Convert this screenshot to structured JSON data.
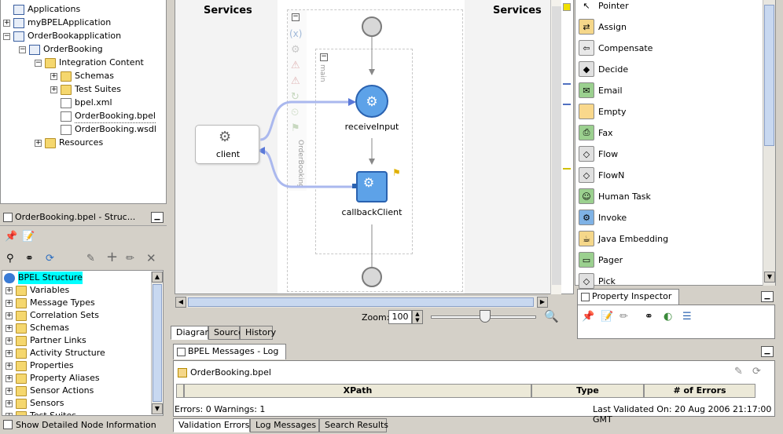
{
  "app_tree": {
    "items": [
      {
        "label": "Applications",
        "level": 0,
        "expander": "",
        "icon": "applications-icon"
      },
      {
        "label": "myBPELApplication",
        "level": 0,
        "expander": "+",
        "icon": "application-icon"
      },
      {
        "label": "OrderBookapplication",
        "level": 0,
        "expander": "−",
        "icon": "application-icon"
      },
      {
        "label": "OrderBooking",
        "level": 1,
        "expander": "−",
        "icon": "project-icon"
      },
      {
        "label": "Integration Content",
        "level": 2,
        "expander": "−",
        "icon": "folder-icon"
      },
      {
        "label": "Schemas",
        "level": 3,
        "expander": "+",
        "icon": "folder-icon"
      },
      {
        "label": "Test Suites",
        "level": 3,
        "expander": "+",
        "icon": "folder-icon"
      },
      {
        "label": "bpel.xml",
        "level": 3,
        "expander": "",
        "icon": "xml-file-icon"
      },
      {
        "label": "OrderBooking.bpel",
        "level": 3,
        "expander": "",
        "icon": "bpel-file-icon"
      },
      {
        "label": "OrderBooking.wsdl",
        "level": 3,
        "expander": "",
        "icon": "wsdl-file-icon"
      },
      {
        "label": "Resources",
        "level": 2,
        "expander": "+",
        "icon": "folder-icon"
      }
    ]
  },
  "structure_panel": {
    "title": "OrderBooking.bpel - Struc...",
    "root": "BPEL Structure",
    "items": [
      "Variables",
      "Message Types",
      "Correlation Sets",
      "Schemas",
      "Partner Links",
      "Activity Structure",
      "Properties",
      "Property Aliases",
      "Sensor Actions",
      "Sensors",
      "Test Suites"
    ],
    "show_detailed": "Show Detailed Node Information"
  },
  "diagram": {
    "services_left": "Services",
    "services_right": "Services",
    "client_label": "client",
    "receive_label": "receiveInput",
    "callback_label": "callbackClient",
    "scope_label": "main",
    "process_label": "OrderBooking",
    "zoom_label": "Zoom:",
    "zoom_value": "100",
    "tabs": [
      "Diagram",
      "Source",
      "History"
    ]
  },
  "palette": {
    "items": [
      {
        "label": "Pointer",
        "glyph": "↖",
        "bg": "#ffffff"
      },
      {
        "label": "Assign",
        "glyph": "⇄",
        "bg": "#f5d78a"
      },
      {
        "label": "Compensate",
        "glyph": "⇦",
        "bg": "#e8e8e8"
      },
      {
        "label": "Decide",
        "glyph": "◆",
        "bg": "#e0e0e0"
      },
      {
        "label": "Email",
        "glyph": "✉",
        "bg": "#9bd08f"
      },
      {
        "label": "Empty",
        "glyph": "",
        "bg": "#f9d88c"
      },
      {
        "label": "Fax",
        "glyph": "⎙",
        "bg": "#9bd08f"
      },
      {
        "label": "Flow",
        "glyph": "◇",
        "bg": "#e0e0e0"
      },
      {
        "label": "FlowN",
        "glyph": "◇",
        "bg": "#e0e0e0"
      },
      {
        "label": "Human Task",
        "glyph": "☺",
        "bg": "#9bd08f"
      },
      {
        "label": "Invoke",
        "glyph": "⚙",
        "bg": "#7fb2e5"
      },
      {
        "label": "Java Embedding",
        "glyph": "☕",
        "bg": "#f5d78a"
      },
      {
        "label": "Pager",
        "glyph": "▭",
        "bg": "#9bd08f"
      },
      {
        "label": "Pick",
        "glyph": "◇",
        "bg": "#e0e0e0"
      }
    ]
  },
  "property_inspector": {
    "title": "Property Inspector"
  },
  "log": {
    "title": "BPEL Messages - Log",
    "file": "OrderBooking.bpel",
    "columns": [
      "XPath",
      "Type",
      "# of Errors"
    ],
    "status_left": "Errors: 0 Warnings: 1",
    "status_right": "Last Validated On: 20 Aug 2006 21:17:00 GMT",
    "tabs": [
      "Validation Errors",
      "Log Messages",
      "Search Results"
    ]
  }
}
